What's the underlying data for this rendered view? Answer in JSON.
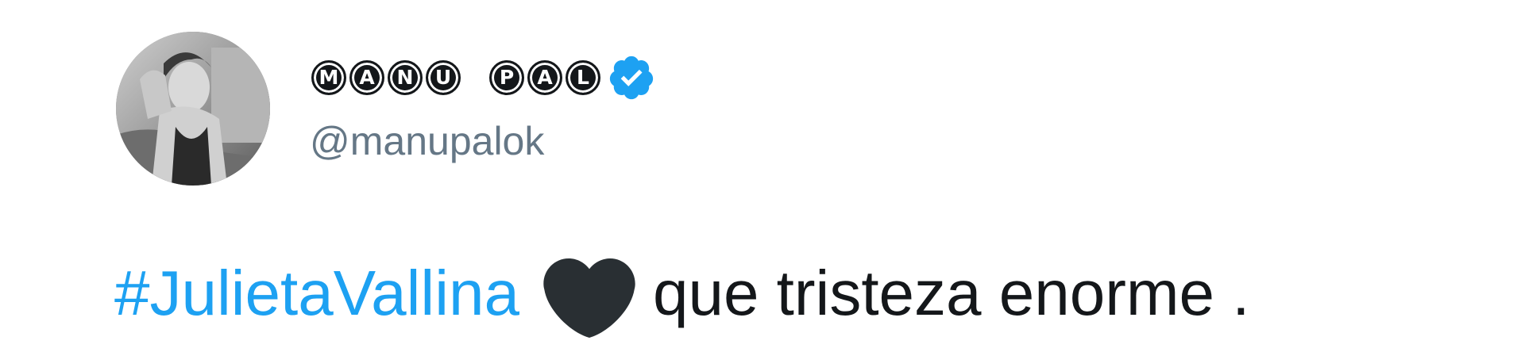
{
  "author": {
    "display_name_word1": [
      "M",
      "A",
      "N",
      "U"
    ],
    "display_name_word2": [
      "P",
      "A",
      "L"
    ],
    "verified": true,
    "handle": "@manupalok",
    "avatar": "profile-photo"
  },
  "tweet": {
    "hashtag": "#JulietaVallina",
    "emoji": "black-heart",
    "text": "que tristeza enorme ."
  },
  "colors": {
    "hashtag": "#1da1f2",
    "verified_badge": "#1da1f2",
    "handle": "#657786",
    "text": "#14171a",
    "heart": "#292f33"
  }
}
